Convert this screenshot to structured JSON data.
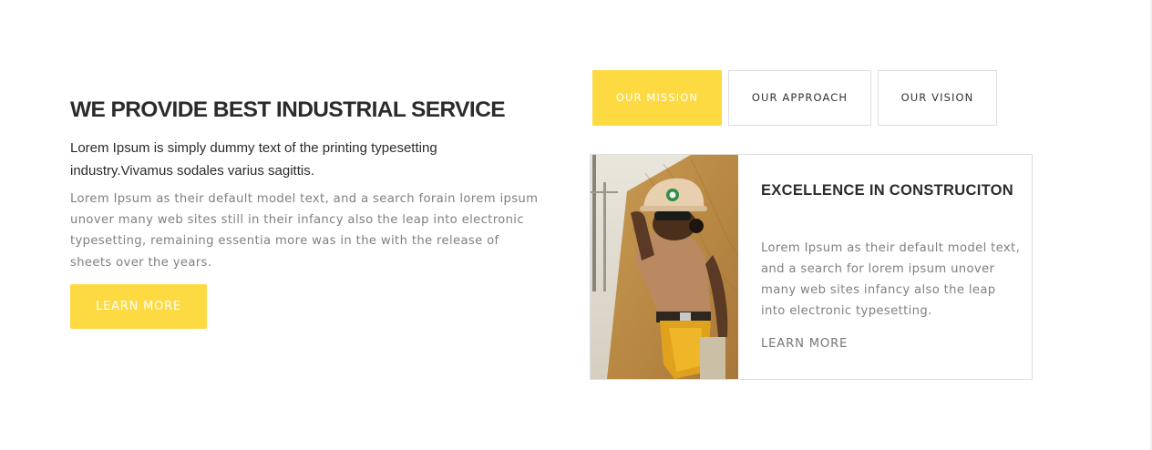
{
  "intro": {
    "heading": "WE PROVIDE BEST INDUSTRIAL SERVICE",
    "lead": "Lorem Ipsum is simply dummy text of the printing typesetting industry.Vivamus sodales varius sagittis.",
    "body": "Lorem Ipsum as their default model text, and a search forain lorem ipsum unover many web sites still in their infancy also the leap into electronic typesetting, remaining essentia more was in the with the release of sheets over the years.",
    "button_label": "LEARN MORE"
  },
  "tabs": [
    {
      "label": "OUR MISSION",
      "active": true
    },
    {
      "label": "OUR APPROACH",
      "active": false
    },
    {
      "label": "OUR VISION",
      "active": false
    }
  ],
  "card": {
    "image_icon": "construction-worker-photo",
    "title": "EXCELLENCE IN CONSTRUCITON",
    "text": "Lorem Ipsum as their default model text, and a search for lorem ipsum unover many web sites infancy also the leap into electronic typesetting.",
    "link_label": "LEARN MORE"
  },
  "colors": {
    "accent": "#fdd942",
    "heading": "#2b2b2b",
    "body": "#808080",
    "border": "#dddddd"
  }
}
